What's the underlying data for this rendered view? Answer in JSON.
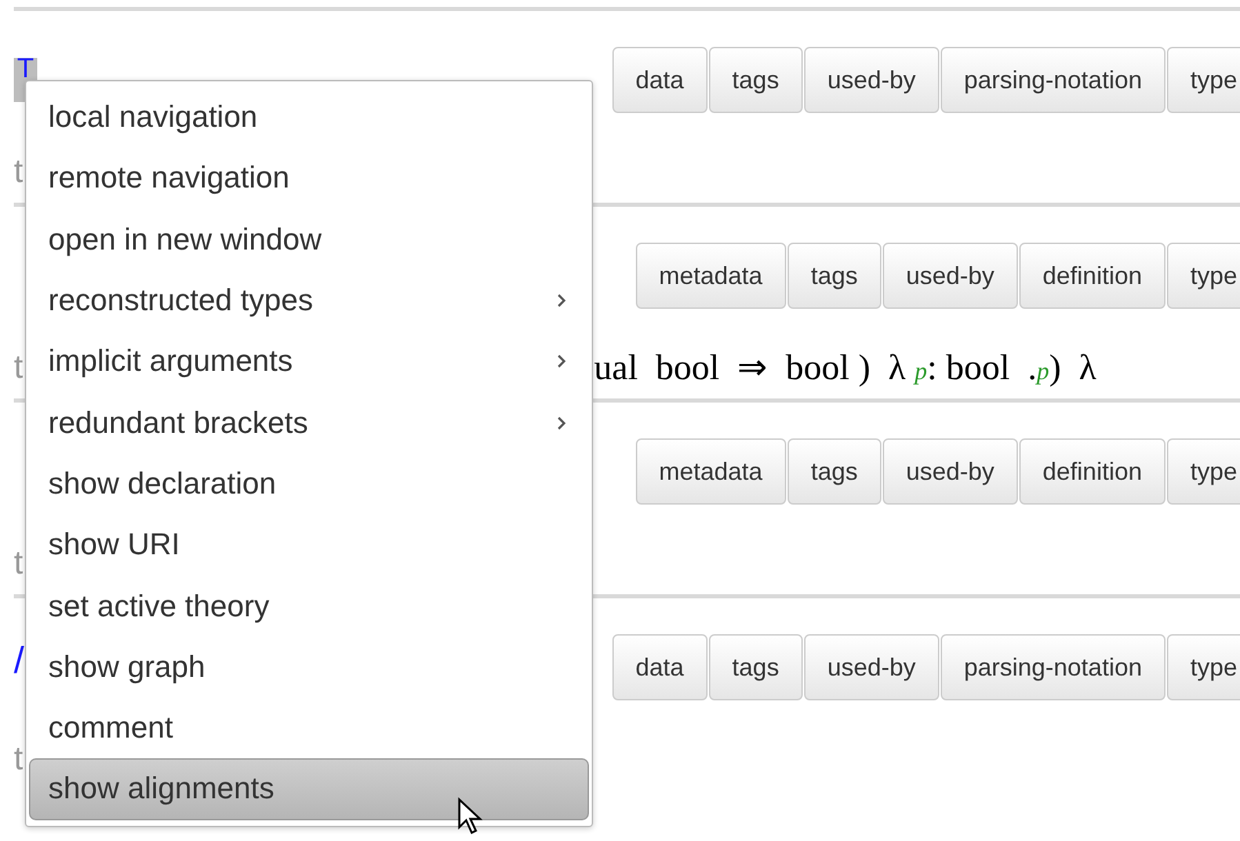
{
  "sections": [
    {
      "symbol": "T",
      "highlighted": true,
      "buttons": [
        "data",
        "tags",
        "used-by",
        "parsing-notation",
        "type"
      ],
      "line": [
        {
          "text": "t",
          "kind": "lead"
        }
      ]
    },
    {
      "buttons": [
        "metadata",
        "tags",
        "used-by",
        "definition",
        "type"
      ],
      "line": [
        {
          "text": "t",
          "kind": "lead"
        },
        {
          "text": "ual  bool  ⇒  bool )  λ ",
          "kind": "term"
        },
        {
          "text": "p",
          "kind": "var"
        },
        {
          "text": ": bool  .",
          "kind": "term"
        },
        {
          "text": "p",
          "kind": "var"
        },
        {
          "text": ")  λ",
          "kind": "term"
        }
      ]
    },
    {
      "buttons": [
        "metadata",
        "tags",
        "used-by",
        "definition",
        "type"
      ],
      "line": [
        {
          "text": "t",
          "kind": "lead"
        }
      ]
    },
    {
      "symbol": "/",
      "highlighted": false,
      "buttons": [
        "data",
        "tags",
        "used-by",
        "parsing-notation",
        "type"
      ],
      "line": [
        {
          "text": "t",
          "kind": "lead"
        }
      ]
    }
  ],
  "context_menu": {
    "items": [
      {
        "label": "local navigation",
        "submenu": false,
        "selected": false
      },
      {
        "label": "remote navigation",
        "submenu": false,
        "selected": false
      },
      {
        "label": "open in new window",
        "submenu": false,
        "selected": false
      },
      {
        "label": "reconstructed types",
        "submenu": true,
        "selected": false
      },
      {
        "label": "implicit arguments",
        "submenu": true,
        "selected": false
      },
      {
        "label": "redundant brackets",
        "submenu": true,
        "selected": false
      },
      {
        "label": "show declaration",
        "submenu": false,
        "selected": false
      },
      {
        "label": "show URI",
        "submenu": false,
        "selected": false
      },
      {
        "label": "set active theory",
        "submenu": false,
        "selected": false
      },
      {
        "label": "show graph",
        "submenu": false,
        "selected": false
      },
      {
        "label": "comment",
        "submenu": false,
        "selected": false
      },
      {
        "label": "show alignments",
        "submenu": false,
        "selected": true
      }
    ]
  }
}
